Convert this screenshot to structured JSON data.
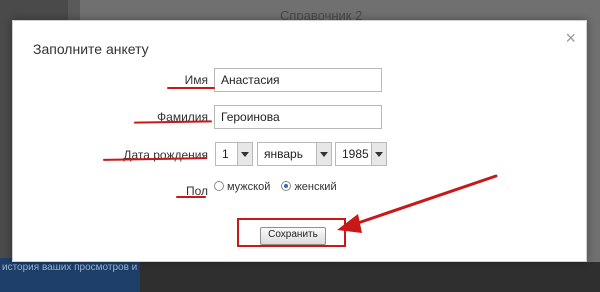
{
  "background": {
    "heading": "Справочник 2",
    "news_text": "история ваших просмотров и страница пароля"
  },
  "modal": {
    "title": "Заполните анкету",
    "close_symbol": "×",
    "fields": {
      "first_name": {
        "label": "Имя",
        "value": "Анастасия"
      },
      "last_name": {
        "label": "Фамилия",
        "value": "Героинова"
      },
      "birthdate": {
        "label": "Дата рождения",
        "day": "1",
        "month": "январь",
        "year": "1985"
      },
      "gender": {
        "label": "Пол",
        "options": [
          "мужской",
          "женский"
        ],
        "selected": "женский"
      }
    },
    "save_label": "Сохранить"
  },
  "colors": {
    "annotation": "#c81818",
    "radio_selected": "#2f6ebf"
  }
}
